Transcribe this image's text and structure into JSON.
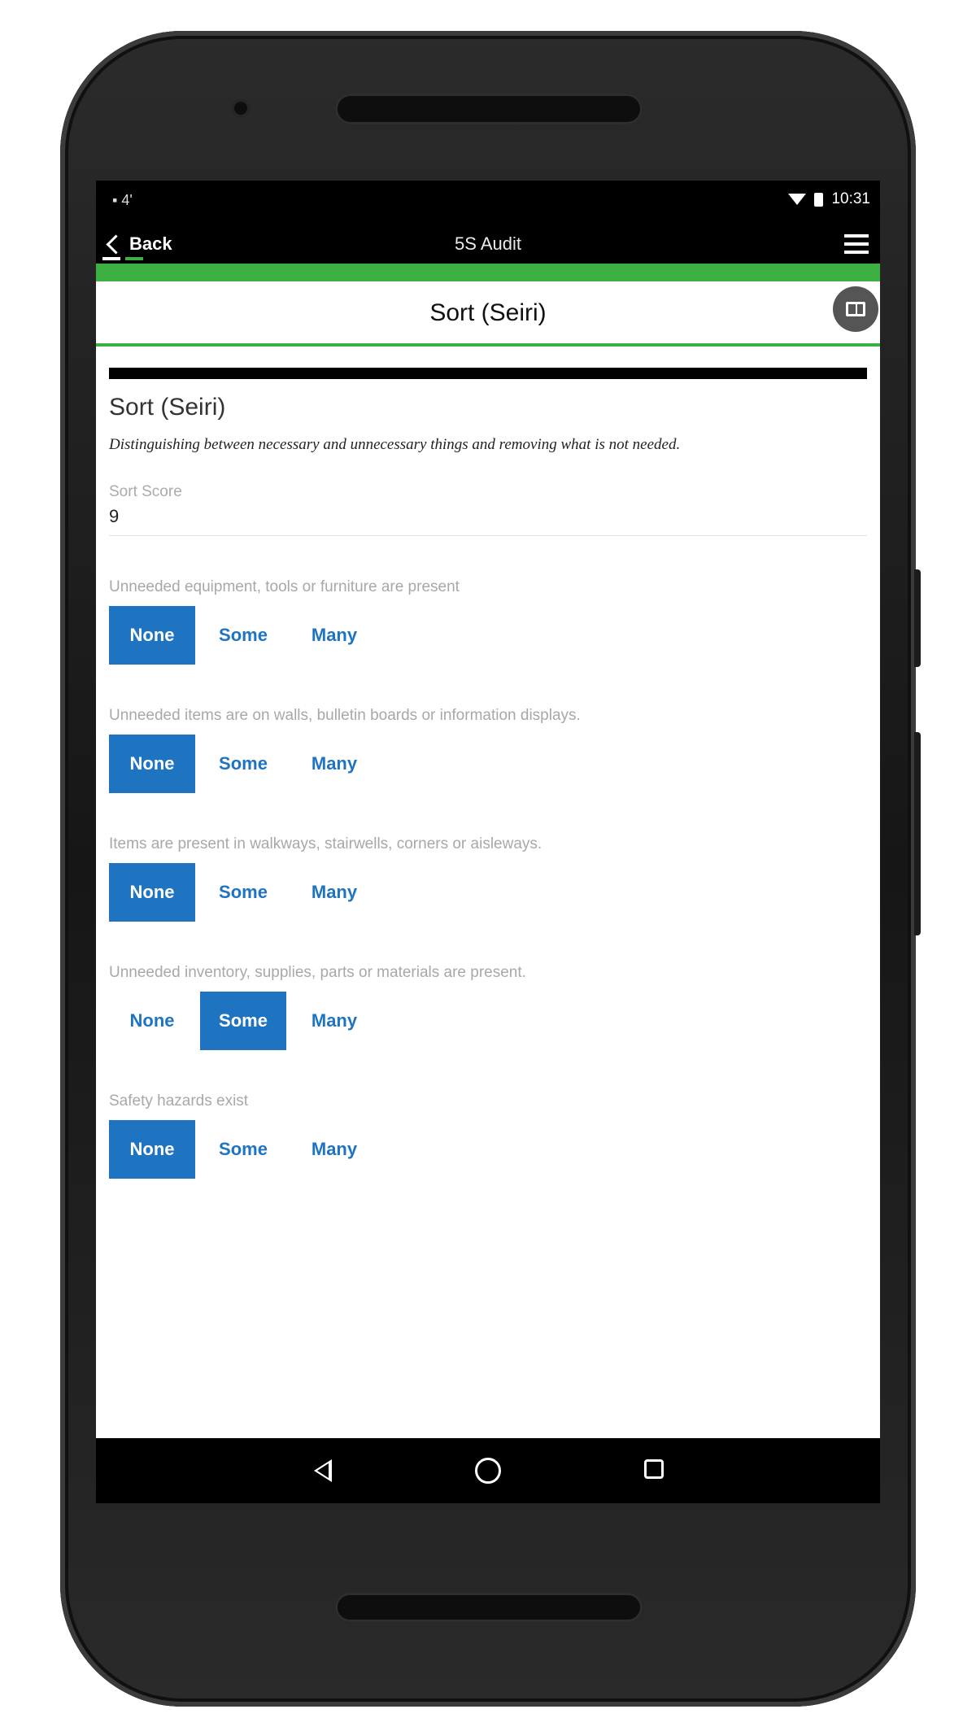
{
  "status_bar": {
    "left_text": "▪ 4'",
    "time": "10:31"
  },
  "app_bar": {
    "back_label": "Back",
    "title": "5S Audit"
  },
  "section": {
    "header_title": "Sort (Seiri)",
    "title": "Sort (Seiri)",
    "description": "Distinguishing between necessary and unnecessary things and removing what is not needed."
  },
  "score": {
    "label": "Sort Score",
    "value": "9"
  },
  "options": [
    "None",
    "Some",
    "Many"
  ],
  "questions": [
    {
      "label": "Unneeded equipment, tools or furniture are present",
      "selected": "None"
    },
    {
      "label": "Unneeded items are on walls, bulletin boards or information displays.",
      "selected": "None"
    },
    {
      "label": "Items are present in walkways, stairwells, corners or aisleways.",
      "selected": "None"
    },
    {
      "label": "Unneeded inventory, supplies, parts or materials are present.",
      "selected": "Some"
    },
    {
      "label": "Safety hazards exist",
      "selected": "None"
    }
  ],
  "colors": {
    "accent_green": "#3cb043",
    "selected_blue": "#1f74c2"
  },
  "icons": {
    "menu": "hamburger-menu-icon",
    "reference": "book-icon",
    "nav_back": "triangle-back-icon",
    "nav_home": "circle-home-icon",
    "nav_recent": "square-recent-icon"
  }
}
